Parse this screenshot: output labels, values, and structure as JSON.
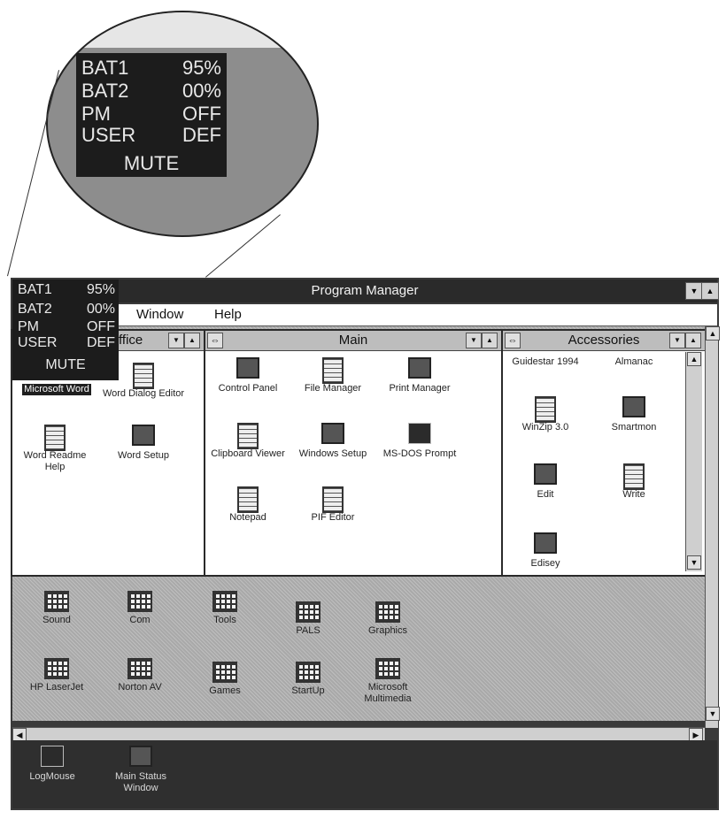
{
  "overlay": {
    "rows": [
      {
        "key": "BAT1",
        "value": "95%"
      },
      {
        "key": "BAT2",
        "value": "00%"
      },
      {
        "key": "PM",
        "value": "OFF"
      },
      {
        "key": "USER",
        "value": "DEF"
      }
    ],
    "mute": "MUTE"
  },
  "window": {
    "title": "Program Manager"
  },
  "menu": {
    "window": "Window",
    "help": "Help"
  },
  "office_group": {
    "title_partial": "ffice",
    "icons": [
      {
        "label": "Microsoft Word",
        "selected": true
      },
      {
        "label": "Word Dialog Editor"
      },
      {
        "label": "Word Readme Help"
      },
      {
        "label": "Word Setup"
      }
    ]
  },
  "main_group": {
    "title": "Main",
    "icons": [
      {
        "label": "Control Panel"
      },
      {
        "label": "File Manager"
      },
      {
        "label": "Print Manager"
      },
      {
        "label": "Clipboard Viewer"
      },
      {
        "label": "Windows Setup"
      },
      {
        "label": "MS-DOS Prompt"
      },
      {
        "label": "Notepad"
      },
      {
        "label": "PIF Editor"
      }
    ]
  },
  "accessories_group": {
    "title": "Accessories",
    "icons": [
      {
        "label": "Guidestar 1994"
      },
      {
        "label": "Almanac"
      },
      {
        "label": "WinZip 3.0"
      },
      {
        "label": "Smartmon"
      },
      {
        "label": "Edit"
      },
      {
        "label": "Write"
      },
      {
        "label": "Edisey"
      }
    ]
  },
  "minimized_groups": [
    {
      "label": "Sound"
    },
    {
      "label": "Com"
    },
    {
      "label": "Tools"
    },
    {
      "label": "PALS"
    },
    {
      "label": "Graphics"
    },
    {
      "label": "HP LaserJet"
    },
    {
      "label": "Norton AV"
    },
    {
      "label": "Games"
    },
    {
      "label": "StartUp"
    },
    {
      "label": "Microsoft Multimedia"
    }
  ],
  "desktop_icons": [
    {
      "label": "LogMouse"
    },
    {
      "label": "Main Status Window"
    }
  ]
}
